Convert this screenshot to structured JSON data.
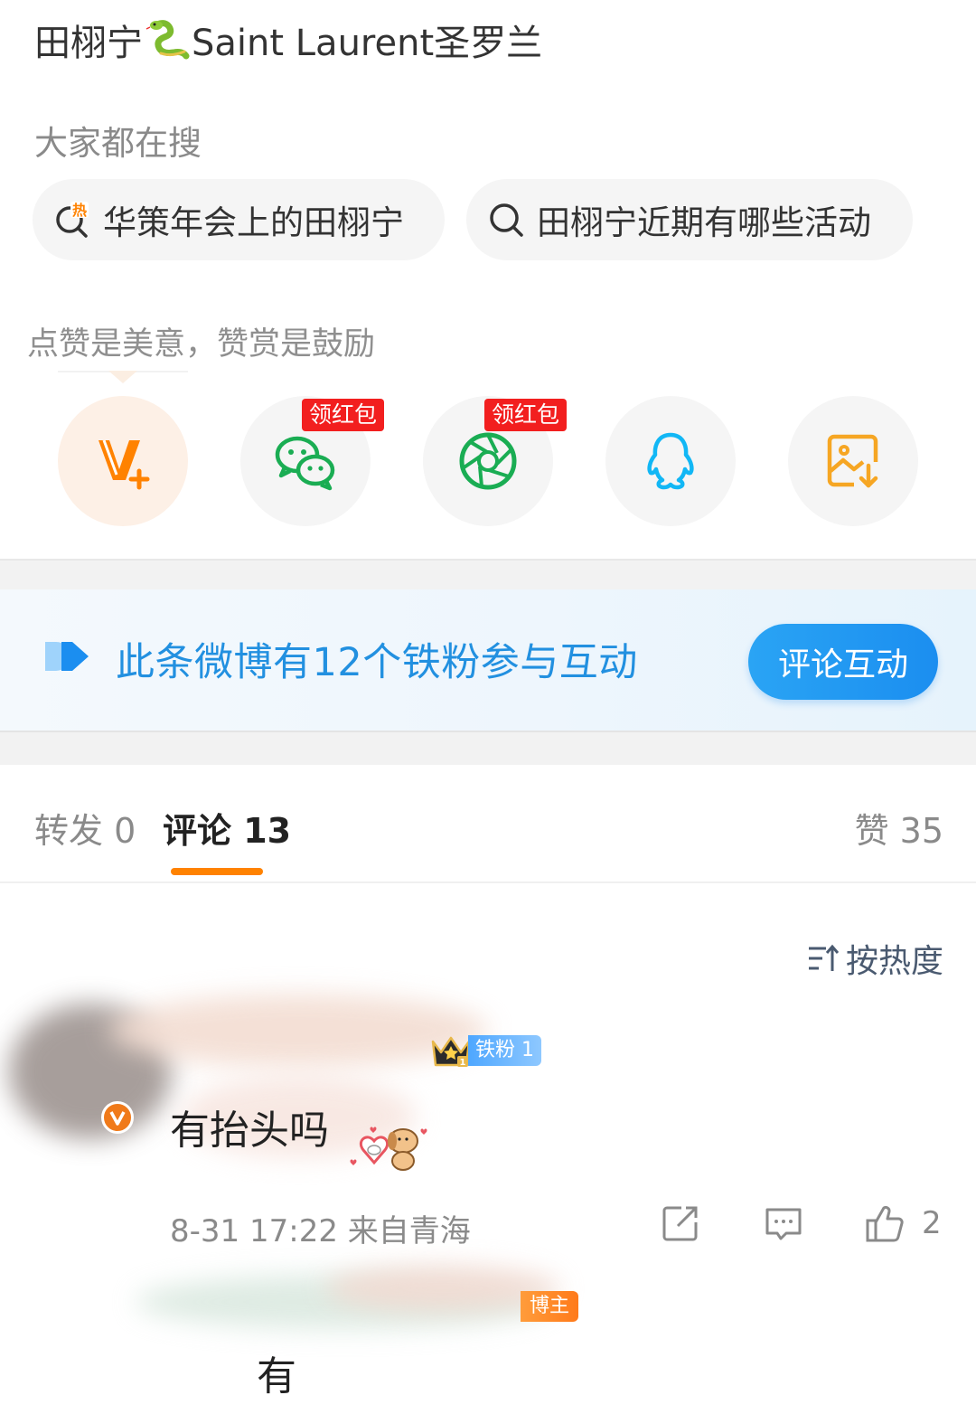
{
  "post": {
    "title_prefix": "田栩宁",
    "title_suffix": "Saint Laurent圣罗兰"
  },
  "search": {
    "label": "大家都在搜",
    "chips": [
      {
        "text": "华策年会上的田栩宁",
        "icon": "hot-search-icon"
      },
      {
        "text": "田栩宁近期有哪些活动",
        "icon": "search-icon"
      }
    ]
  },
  "reward": {
    "label": "点赞是美意，赞赏是鼓励",
    "buttons": [
      {
        "name": "v-plus-icon",
        "badge": ""
      },
      {
        "name": "wechat-icon",
        "badge": "领红包"
      },
      {
        "name": "moments-icon",
        "badge": "领红包"
      },
      {
        "name": "qq-icon",
        "badge": ""
      },
      {
        "name": "save-image-icon",
        "badge": ""
      }
    ]
  },
  "fans_banner": {
    "text": "此条微博有12个铁粉参与互动",
    "button": "评论互动"
  },
  "tabs": {
    "repost": "转发 0",
    "comment": "评论 13",
    "like": "赞 35"
  },
  "sort": {
    "label": "按热度"
  },
  "comments": [
    {
      "fan_badge": "铁粉 1",
      "text": "有抬头吗",
      "time": "8-31 17:22",
      "location": "来自青海",
      "likes": "2"
    }
  ],
  "reply": {
    "badge": "博主",
    "text": "有"
  },
  "colors": {
    "accent_orange": "#ff8200",
    "weibo_blue": "#2290e0",
    "wechat_green": "#1aad53",
    "red_badge": "#f21f1f"
  }
}
